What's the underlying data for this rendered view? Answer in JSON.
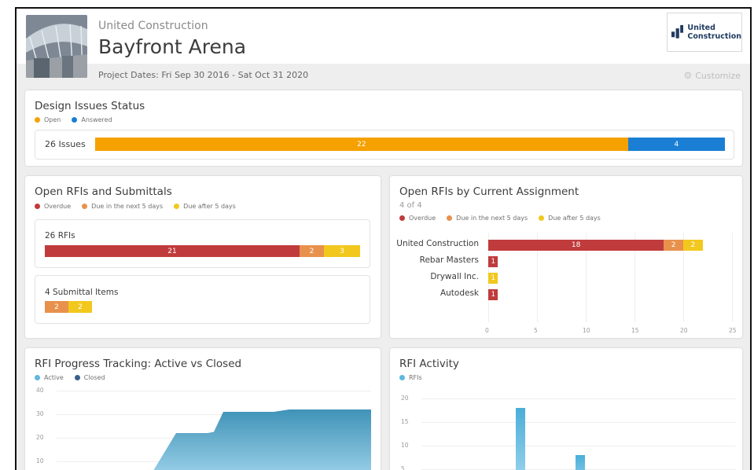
{
  "header": {
    "company": "United Construction",
    "project": "Bayfront Arena",
    "dates": "Project Dates: Fri Sep 30 2016 - Sat Oct 31 2020",
    "customize_label": "Customize",
    "logo_line1": "United",
    "logo_line2": "Construction"
  },
  "design_issues": {
    "title": "Design Issues Status",
    "legend": [
      {
        "label": "Open",
        "color": "#f5a100"
      },
      {
        "label": "Answered",
        "color": "#1a7fd4"
      }
    ],
    "row_label": "26 Issues",
    "segments": [
      {
        "value": 22,
        "label": "22",
        "color": "#f5a100"
      },
      {
        "value": 4,
        "label": "4",
        "color": "#1a7fd4"
      }
    ]
  },
  "open_rfis_submittals": {
    "title": "Open RFIs and Submittals",
    "legend": [
      {
        "label": "Overdue",
        "color": "#c03b3b"
      },
      {
        "label": "Due in the next 5 days",
        "color": "#e8914d"
      },
      {
        "label": "Due after 5 days",
        "color": "#f2c81e"
      }
    ],
    "rfis": {
      "label": "26 RFIs",
      "segments": [
        {
          "value": 21,
          "label": "21",
          "color": "#c03b3b"
        },
        {
          "value": 2,
          "label": "2",
          "color": "#e8914d"
        },
        {
          "value": 3,
          "label": "3",
          "color": "#f2c81e"
        }
      ]
    },
    "submittals": {
      "label": "4 Submittal Items",
      "segments": [
        {
          "value": 2,
          "label": "2",
          "color": "#e8914d"
        },
        {
          "value": 2,
          "label": "2",
          "color": "#f2c81e"
        }
      ]
    }
  },
  "rfis_by_assignment": {
    "title": "Open RFIs by Current Assignment",
    "subtitle": "4 of 4",
    "legend": [
      {
        "label": "Overdue",
        "color": "#c03b3b"
      },
      {
        "label": "Due in the next 5 days",
        "color": "#e8914d"
      },
      {
        "label": "Due after 5 days",
        "color": "#f2c81e"
      }
    ],
    "axis_ticks": [
      "0",
      "5",
      "10",
      "15",
      "20",
      "25"
    ]
  },
  "rfi_progress": {
    "title": "RFI Progress Tracking: Active vs Closed",
    "legend": [
      {
        "label": "Active",
        "color": "#5fb8e0"
      },
      {
        "label": "Closed",
        "color": "#3b5f8c"
      }
    ],
    "y_ticks": [
      "40",
      "30",
      "20",
      "10"
    ]
  },
  "rfi_activity": {
    "title": "RFI Activity",
    "legend": [
      {
        "label": "RFIs",
        "color": "#5fb8e0"
      }
    ],
    "y_ticks": [
      "20",
      "15",
      "10",
      "5"
    ]
  },
  "chart_data": [
    {
      "type": "bar",
      "title": "Open RFIs by Current Assignment",
      "categories": [
        "United Construction",
        "Rebar Masters",
        "Drywall Inc.",
        "Autodesk"
      ],
      "series": [
        {
          "name": "Overdue",
          "values": [
            18,
            1,
            0,
            1
          ],
          "color": "#c03b3b"
        },
        {
          "name": "Due in the next 5 days",
          "values": [
            2,
            0,
            0,
            0
          ],
          "color": "#e8914d"
        },
        {
          "name": "Due after 5 days",
          "values": [
            2,
            0,
            1,
            0
          ],
          "color": "#f2c81e"
        }
      ],
      "xlim": [
        0,
        25
      ],
      "orientation": "horizontal",
      "stacked": true
    },
    {
      "type": "area",
      "title": "RFI Progress Tracking: Active vs Closed",
      "ylim": [
        0,
        40
      ],
      "series": [
        {
          "name": "Active",
          "x": [
            0,
            0.28,
            0.38,
            0.47,
            0.48,
            0.5,
            0.53,
            0.69,
            0.74,
            1.0
          ],
          "values": [
            0,
            0,
            22,
            22,
            22,
            22.5,
            31,
            31,
            32,
            32
          ]
        }
      ]
    },
    {
      "type": "bar",
      "title": "RFI Activity",
      "ylim": [
        0,
        20
      ],
      "series": [
        {
          "name": "RFIs",
          "x": [
            0.3,
            0.49
          ],
          "values": [
            18,
            8
          ]
        }
      ]
    }
  ]
}
